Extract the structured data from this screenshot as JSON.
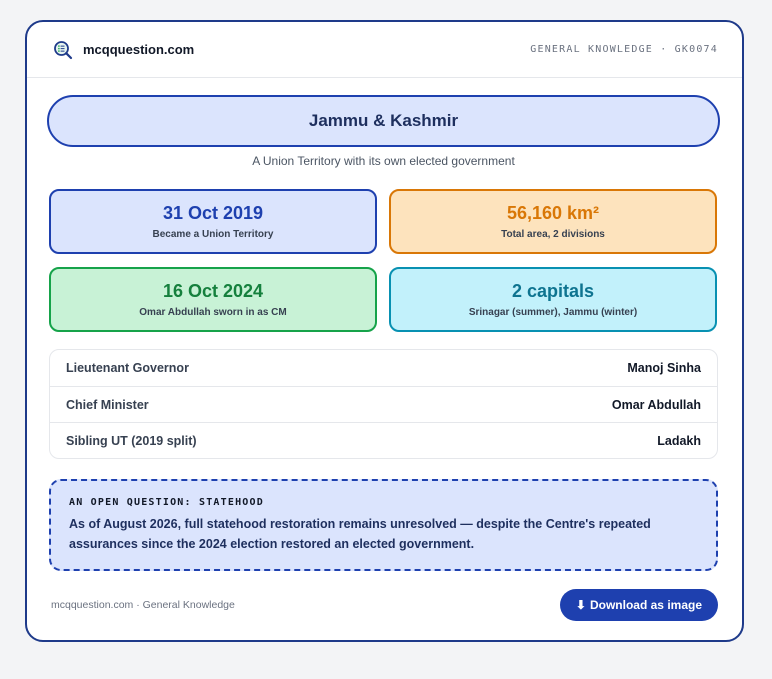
{
  "header": {
    "brand_name": "mcqquestion.com",
    "meta": "GENERAL KNOWLEDGE · GK0074",
    "logo_icon": "magnifier-list-icon"
  },
  "hero": {
    "title": "Jammu & Kashmir",
    "subtitle": "A Union Territory with its own elected government"
  },
  "stats": [
    {
      "value": "31 Oct 2019",
      "label": "Became a Union Territory",
      "color": "#1e40af"
    },
    {
      "value": "56,160 km²",
      "label": "Total area, 2 divisions",
      "color": "#d97706"
    },
    {
      "value": "16 Oct 2024",
      "label": "Omar Abdullah sworn in as CM",
      "color": "#16a34a"
    },
    {
      "value": "2 capitals",
      "label": "Srinagar (summer), Jammu (winter)",
      "color": "#0891b2"
    }
  ],
  "info_rows": [
    {
      "label": "Lieutenant Governor",
      "value": "Manoj Sinha"
    },
    {
      "label": "Chief Minister",
      "value": "Omar Abdullah"
    },
    {
      "label": "Sibling UT (2019 split)",
      "value": "Ladakh"
    }
  ],
  "note": {
    "heading": "AN OPEN QUESTION: STATEHOOD",
    "body": "As of August 2026, full statehood restoration remains unresolved — despite the Centre's repeated assurances since the 2024 election restored an elected government."
  },
  "footer": {
    "text": "mcqquestion.com · General Knowledge",
    "download_icon": "download-arrow-icon",
    "download_glyph": "⬇",
    "download_label": "Download as image"
  }
}
